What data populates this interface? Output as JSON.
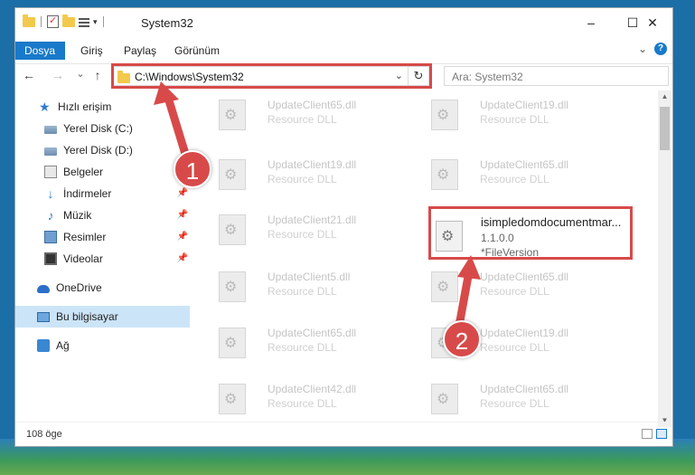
{
  "window": {
    "title": "System32",
    "controls": {
      "minimize": "–",
      "maximize": "☐",
      "close": "✕"
    }
  },
  "ribbon": {
    "tabs": [
      {
        "label": "Dosya",
        "active": true
      },
      {
        "label": "Giriş"
      },
      {
        "label": "Paylaş"
      },
      {
        "label": "Görünüm"
      }
    ],
    "expand": "⌄",
    "help": "?"
  },
  "nav": {
    "back": "←",
    "forward": "→",
    "recent": "⌄",
    "up": "↑",
    "address": "C:\\Windows\\System32",
    "address_dropdown": "⌄",
    "refresh": "↻",
    "search_placeholder": "Ara: System32"
  },
  "sidebar": {
    "items": [
      {
        "label": "Hızlı erişim",
        "icon": "star-icon"
      },
      {
        "label": "Yerel Disk (C:)",
        "icon": "disk-icon"
      },
      {
        "label": "Yerel Disk (D:)",
        "icon": "disk-icon"
      },
      {
        "label": "Belgeler",
        "icon": "documents-icon"
      },
      {
        "label": "İndirmeler",
        "icon": "downloads-icon",
        "pinned": true
      },
      {
        "label": "Müzik",
        "icon": "music-icon",
        "pinned": true
      },
      {
        "label": "Resimler",
        "icon": "pictures-icon",
        "pinned": true
      },
      {
        "label": "Videolar",
        "icon": "videos-icon",
        "pinned": true
      },
      {
        "label": "OneDrive",
        "icon": "onedrive-icon"
      },
      {
        "label": "Bu bilgisayar",
        "icon": "computer-icon",
        "selected": true
      },
      {
        "label": "Ağ",
        "icon": "network-icon"
      }
    ],
    "pin_glyph": "📌"
  },
  "files": [
    {
      "name": "UpdateClient65.dll",
      "desc": "Resource DLL"
    },
    {
      "name": "UpdateClient19.dll",
      "desc": "Resource DLL"
    },
    {
      "name": "UpdateClient19.dll",
      "desc": "Resource DLL"
    },
    {
      "name": "UpdateClient65.dll",
      "desc": "Resource DLL"
    },
    {
      "name": "UpdateClient21.dll",
      "desc": "Resource DLL"
    },
    {
      "name": "isimpledomdocumentmar...",
      "desc": "1.1.0.0",
      "desc2": "*FileVersion"
    },
    {
      "name": "UpdateClient5.dll",
      "desc": "Resource DLL"
    },
    {
      "name": "UpdateClient65.dll",
      "desc": "Resource DLL"
    },
    {
      "name": "UpdateClient65.dll",
      "desc": "Resource DLL"
    },
    {
      "name": "UpdateClient19.dll",
      "desc": "Resource DLL"
    },
    {
      "name": "UpdateClient42.dll",
      "desc": "Resource DLL"
    },
    {
      "name": "UpdateClient65.dll",
      "desc": "Resource DLL"
    }
  ],
  "status": {
    "count": "108 öge"
  },
  "callouts": {
    "one": "1",
    "two": "2"
  },
  "colors": {
    "accent": "#1979ca",
    "highlight": "#d84a4a",
    "selected": "#cce4f7"
  }
}
